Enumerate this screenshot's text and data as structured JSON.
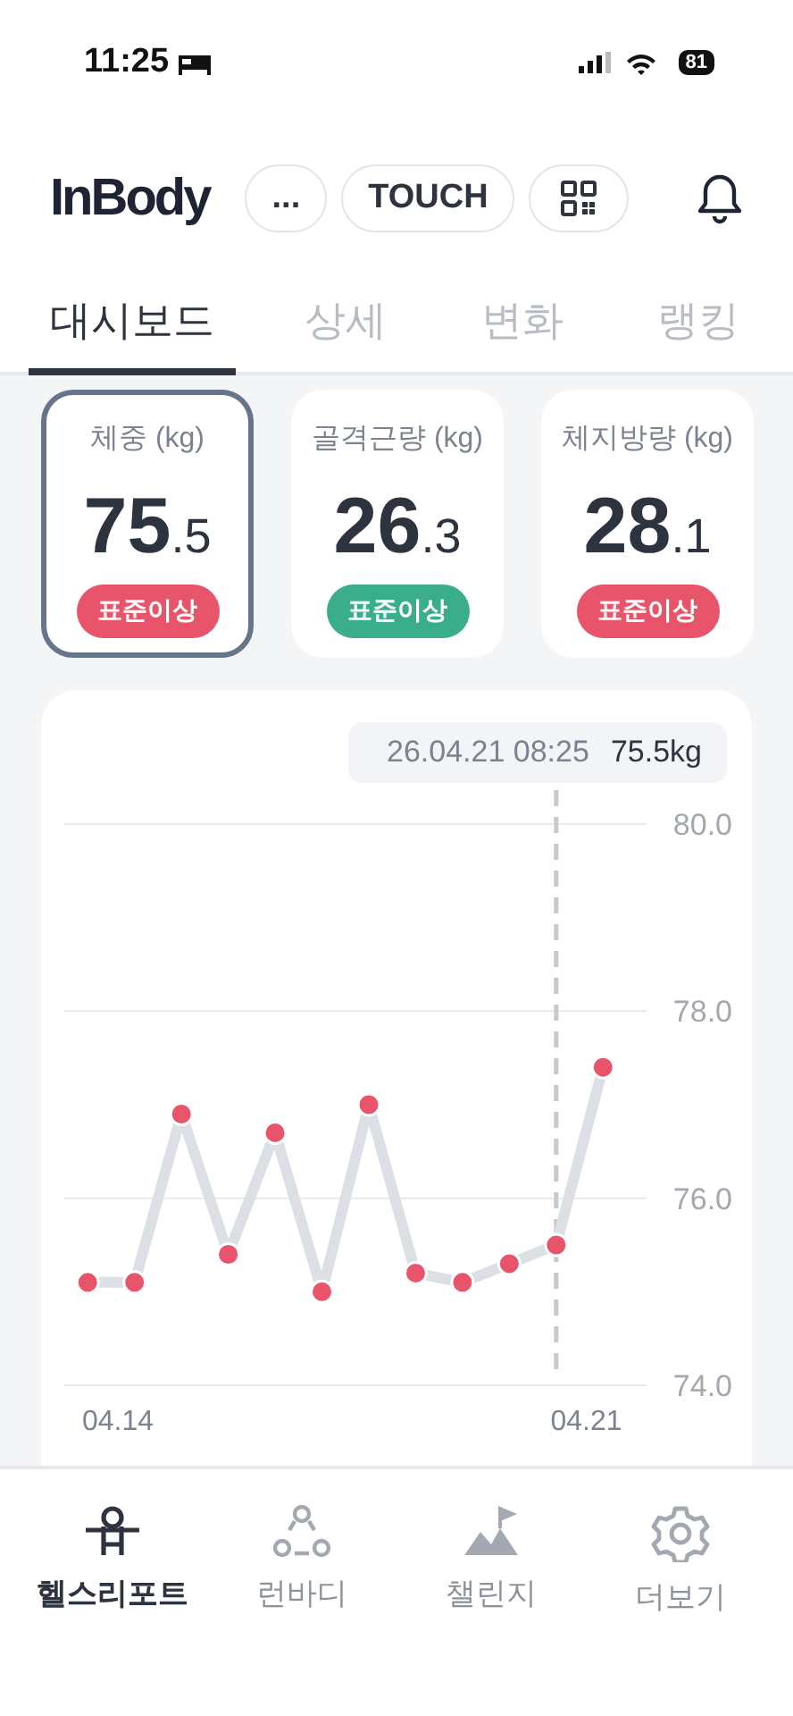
{
  "status_bar": {
    "time": "11:25",
    "battery": "81"
  },
  "header": {
    "logo": "InBody",
    "buttons": [
      {
        "kind": "text",
        "label": "..."
      },
      {
        "kind": "text",
        "label": "TOUCH"
      },
      {
        "kind": "qr"
      }
    ]
  },
  "tabs": [
    {
      "label": "대시보드",
      "selected": true
    },
    {
      "label": "상세",
      "selected": false
    },
    {
      "label": "변화",
      "selected": false
    },
    {
      "label": "랭킹",
      "selected": false
    }
  ],
  "metrics": [
    {
      "label": "체중 (kg)",
      "value": "75",
      "decimal": ".5",
      "status": "표준이상",
      "color": "#e8546a",
      "selected": true
    },
    {
      "label": "골격근량 (kg)",
      "value": "26",
      "decimal": ".3",
      "status": "표준이상",
      "color": "#3aae8a",
      "selected": false
    },
    {
      "label": "체지방량 (kg)",
      "value": "28",
      "decimal": ".1",
      "status": "표준이상",
      "color": "#e8546a",
      "selected": false
    }
  ],
  "chart": {
    "tooltip": {
      "date": "26.04.21 08:25",
      "value": "75.5kg"
    },
    "chart_data": {
      "type": "line",
      "x": [
        4.1355,
        4.1425,
        4.1495,
        4.1565,
        4.1635,
        4.1705,
        4.1775,
        4.1845,
        4.1915,
        4.1985,
        4.2055,
        4.2125
      ],
      "xlim": [
        4.132,
        4.219
      ],
      "series": [
        {
          "color": "#e8546a",
          "marker": "o",
          "values": [
            75.1,
            75.1,
            76.9,
            75.4,
            76.7,
            75.0,
            77.0,
            75.2,
            75.1,
            75.3,
            75.5,
            77.4
          ]
        }
      ],
      "ylim": [
        74,
        80
      ],
      "yticks": [
        {
          "value": 80,
          "label": "80.0"
        },
        {
          "value": 78,
          "label": "78.0"
        },
        {
          "value": 76,
          "label": "76.0"
        },
        {
          "value": 74,
          "label": "74.0"
        }
      ],
      "xticks": [
        {
          "value": 4.14,
          "label": "04.14"
        },
        {
          "value": 4.21,
          "label": "04.21"
        }
      ],
      "ref_lines": [
        {
          "axis": "x",
          "value": 4.2055
        }
      ]
    }
  },
  "bottom_nav": [
    {
      "kind": "person",
      "label": "헬스리포트",
      "selected": true
    },
    {
      "kind": "circles",
      "label": "런바디",
      "selected": false
    },
    {
      "kind": "mountain",
      "label": "챌린지",
      "selected": false
    },
    {
      "kind": "gear",
      "label": "더보기",
      "selected": false
    }
  ]
}
